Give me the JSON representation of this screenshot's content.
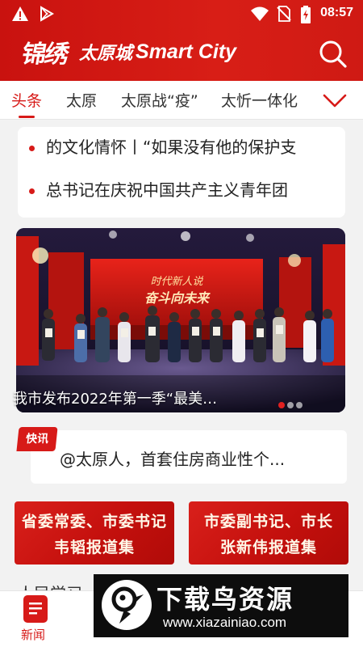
{
  "status_bar": {
    "time": "08:57",
    "icons": [
      "warning-icon",
      "play-store-icon",
      "wifi-icon",
      "no-sim-icon",
      "battery-charging-icon"
    ]
  },
  "header": {
    "brand_calligraphy": "锦绣",
    "brand_cn": "太原城",
    "brand_en": "Smart City",
    "search_icon": "search-icon",
    "color": "#d81e16"
  },
  "tabs": {
    "items": [
      {
        "label": "头条",
        "active": true
      },
      {
        "label": "太原",
        "active": false
      },
      {
        "label": "太原战“疫”",
        "active": false
      },
      {
        "label": "太忻一体化",
        "active": false
      }
    ],
    "more_icon": "chevron-down-icon",
    "accent": "#d71a18"
  },
  "ticker": {
    "items": [
      "的文化情怀丨“如果没有他的保护支",
      "总书记在庆祝中国共产主义青年团"
    ]
  },
  "banner": {
    "caption": "我市发布2022年第一季“最美…",
    "stage_title": "时代新人说",
    "stage_subtitle": "奋斗向未来",
    "current_index": 0,
    "count": 3
  },
  "flash": {
    "badge": "快讯",
    "text": "@太原人，首套住房商业性个..."
  },
  "reports": [
    {
      "line1": "省委常委、市委书记",
      "line2": "韦韬报道集"
    },
    {
      "line1": "市委副书记、市长",
      "line2": "张新伟报道集"
    }
  ],
  "peek_text": "人民学习",
  "bottom_nav": {
    "items": [
      {
        "label": "新闻",
        "icon": "news-icon",
        "active": true
      }
    ]
  },
  "watermark": {
    "title": "下载鸟资源",
    "url": "www.xiazainiao.com"
  }
}
